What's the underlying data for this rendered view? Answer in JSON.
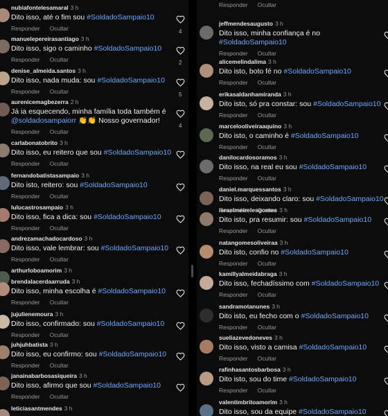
{
  "actions": {
    "reply": "Responder",
    "hide": "Ocultar"
  },
  "left": [
    {
      "user": "nubiafontelesamaral",
      "time": "3 h",
      "lines": [
        [
          "Dito isso, até o fim sou ",
          "#SoldadoSampaio10"
        ]
      ],
      "count": "4",
      "avatar_color": "#a98a7a"
    },
    {
      "user": "manuelepereirasantiago",
      "time": "3 h",
      "lines": [
        [
          "Dito isso, sigo o caminho ",
          "#SoldadoSampaio10"
        ]
      ],
      "count": "2",
      "avatar_color": "#7d6b62"
    },
    {
      "user": "denise_almeida.santos",
      "time": "3 h",
      "lines": [
        [
          "Dito isso, nada muda: sou ",
          "#SoldadoSampaio10"
        ]
      ],
      "count": "5",
      "avatar_color": "#b9a38b"
    },
    {
      "user": "aurenicemagbezerra",
      "time": "2 h",
      "lines": [
        [
          "Já ia esquecendo, minha família toda também é",
          ""
        ],
        [
          "",
          "@soldadosampaiorr",
          " 👏👏 Nosso governador!"
        ]
      ],
      "count": "4",
      "avatar_color": "#6f5d55"
    },
    {
      "user": "carlabonatobrito",
      "time": "3 h",
      "lines": [
        [
          "Dito isso, eu reitero que sou ",
          "#SoldadoSampaio10"
        ]
      ],
      "count": "",
      "avatar_color": "#8c7a6b"
    },
    {
      "user": "fernandobatistasampaio",
      "time": "3 h",
      "lines": [
        [
          "Dito isto, reitero: sou ",
          "#SoldadoSampaio10"
        ]
      ],
      "count": "",
      "avatar_color": "#5f6a78"
    },
    {
      "user": "lulucastrosampaio",
      "time": "3 h",
      "lines": [
        [
          "Dito isso, fica a dica: sou ",
          "#SoldadoSampaio10"
        ]
      ],
      "count": "",
      "avatar_color": "#a37c6d"
    },
    {
      "user": "andrezamachadocardoso",
      "time": "3 h",
      "lines": [
        [
          "Dito isso, vale lembrar: sou ",
          "#SoldadoSampaio10"
        ]
      ],
      "count": "",
      "avatar_color": "#8a6a5e"
    },
    {
      "user": "arthurloboamorim",
      "time": "3 h",
      "lines": [],
      "count": "",
      "avatar_color": "#4e5a4a"
    },
    {
      "user": "brendalacerdaarruda",
      "time": "3 h",
      "lines": [
        [
          "Dito isso, minha escolha é ",
          "#SoldadoSampaio10"
        ]
      ],
      "count": "",
      "avatar_color": "#b48a7a"
    },
    {
      "user": "jujulienemoura",
      "time": "3 h",
      "lines": [
        [
          "Dito isso, confirmado: sou ",
          "#SoldadoSampaio10"
        ]
      ],
      "count": "",
      "avatar_color": "#c9b8a8"
    },
    {
      "user": "juhjuhbatista",
      "time": "3 h",
      "lines": [
        [
          "Dito isso, eu confirmo: sou ",
          "#SoldadoSampaio10"
        ]
      ],
      "count": "",
      "avatar_color": "#9b7e6b"
    },
    {
      "user": "janainabarbosasiqueira",
      "time": "3 h",
      "lines": [
        [
          "Dito isso, afirmo que sou ",
          "#SoldadoSampaio10"
        ]
      ],
      "count": "",
      "avatar_color": "#7b6355"
    },
    {
      "user": "leticiasantmendes",
      "time": "3 h",
      "lines": [],
      "count": "",
      "avatar_color": "#a3897a"
    }
  ],
  "right": [
    {
      "user": "",
      "time": "",
      "lines": [
        [
          "Dito isto, não mudo: sou ",
          "#SoldadoSampaio10"
        ]
      ],
      "avatar_color": ""
    },
    {
      "user": "jeffmendesaugusto",
      "time": "3 h",
      "lines": [
        [
          "Dito isso, minha confiança é no",
          ""
        ],
        [
          "",
          "#SoldadoSampaio10"
        ]
      ],
      "avatar_color": "#6e6a68"
    },
    {
      "user": "alicemelindalima",
      "time": "3 h",
      "lines": [
        [
          "Dito isto, boto fé no ",
          "#SoldadoSampaio10"
        ]
      ],
      "avatar_color": "#b08f7c"
    },
    {
      "user": "erikasaldanhamiranda",
      "time": "3 h",
      "lines": [
        [
          "Dito isto, só pra constar: sou ",
          "#SoldadoSampaio10"
        ]
      ],
      "avatar_color": "#c6b39f"
    },
    {
      "user": "marcelooliveiraaquino",
      "time": "3 h",
      "lines": [
        [
          "Dito isto, o caminho é ",
          "#SoldadoSampaio10"
        ]
      ],
      "avatar_color": "#5d6a52"
    },
    {
      "user": "danilocardosoramos",
      "time": "3 h",
      "lines": [
        [
          "Dito isso, na real eu sou ",
          "#SoldadoSampaio10"
        ]
      ],
      "avatar_color": "#6c6c6c"
    },
    {
      "user": "daniel.marquessantos",
      "time": "3 h",
      "lines": [
        [
          "Dito isso, deixando claro: sou ",
          "#SoldadoSampaio10"
        ]
      ],
      "avatar_color": "#7a6458"
    },
    {
      "user": "israelmeirelesgomes",
      "time": "3 h",
      "lines": [
        [
          "Dito isto, pra resumir: sou ",
          "#SoldadoSampaio10"
        ]
      ],
      "avatar_color": "#8e7a6d"
    },
    {
      "user": "natangomesoliveiraa",
      "time": "3 h",
      "lines": [
        [
          "Dito isto, confio no ",
          "#SoldadoSampaio10"
        ]
      ],
      "avatar_color": "#b58c6e"
    },
    {
      "user": "kamillyalmeidabraga",
      "time": "3 h",
      "lines": [
        [
          "Dito isso, fechadíssimo com ",
          "#SoldadoSampaio10"
        ]
      ],
      "avatar_color": "#c4aa98"
    },
    {
      "user": "sandramotanunes",
      "time": "3 h",
      "lines": [
        [
          "Dito isto, eu fecho com o ",
          "#SoldadoSampaio10"
        ]
      ],
      "avatar_color": "#2e2e2e"
    },
    {
      "user": "sueliazevedoneves",
      "time": "3 h",
      "lines": [
        [
          "Dito isso, visto a camisa ",
          "#SoldadoSampaio10"
        ]
      ],
      "avatar_color": "#a57b62"
    },
    {
      "user": "rafinhasantosbarbosa",
      "time": "3 h",
      "lines": [
        [
          "Dito isto, sou do time ",
          "#SoldadoSampaio10"
        ]
      ],
      "avatar_color": "#b99a86"
    },
    {
      "user": "valentimbritoamorim",
      "time": "3 h",
      "lines": [
        [
          "Dito isso, sou da equipe ",
          "#SoldadoSampaio10"
        ]
      ],
      "avatar_color": "#5b6f86"
    }
  ]
}
